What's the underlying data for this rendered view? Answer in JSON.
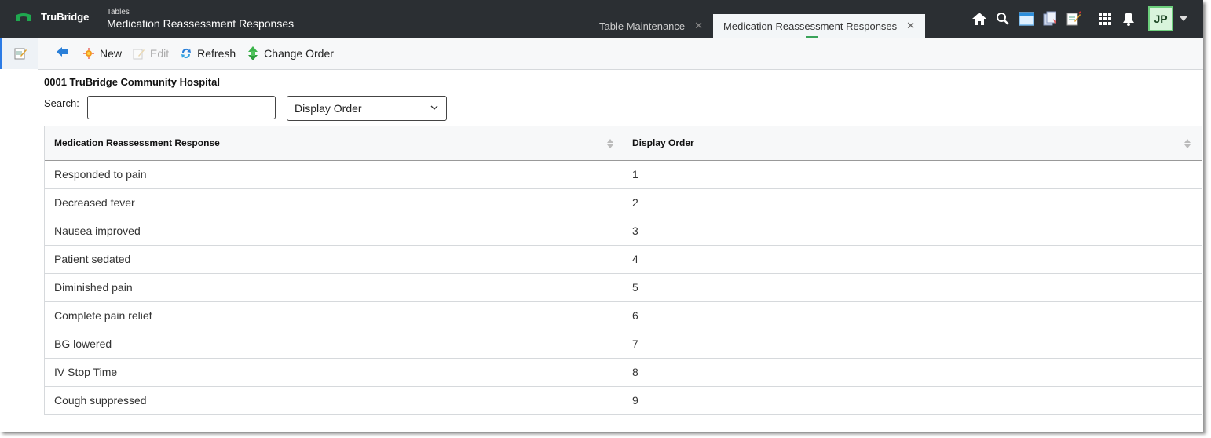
{
  "brand": {
    "name": "TruBridge",
    "accent": "#1fa84f"
  },
  "header": {
    "section": "Tables",
    "title": "Medication Reassessment Responses"
  },
  "tabs": [
    {
      "label": "Table Maintenance",
      "active": false
    },
    {
      "label": "Medication Reassessment Responses",
      "active": true
    }
  ],
  "top_icons": [
    "home-icon",
    "search-icon",
    "window-icon",
    "documents-icon",
    "notes-icon",
    "apps-grid-icon",
    "bell-icon"
  ],
  "user": {
    "initials": "JP"
  },
  "toolbar": {
    "new_label": "New",
    "edit_label": "Edit",
    "refresh_label": "Refresh",
    "change_order_label": "Change Order"
  },
  "facility": "0001 TruBridge Community Hospital",
  "search": {
    "label": "Search:",
    "value": "",
    "sort_selected": "Display Order"
  },
  "table": {
    "columns": [
      "Medication Reassessment Response",
      "Display Order"
    ],
    "rows": [
      {
        "response": "Responded to pain",
        "order": "1"
      },
      {
        "response": "Decreased fever",
        "order": "2"
      },
      {
        "response": "Nausea improved",
        "order": "3"
      },
      {
        "response": "Patient sedated",
        "order": "4"
      },
      {
        "response": "Diminished pain",
        "order": "5"
      },
      {
        "response": "Complete pain relief",
        "order": "6"
      },
      {
        "response": "BG lowered",
        "order": "7"
      },
      {
        "response": "IV Stop Time",
        "order": "8"
      },
      {
        "response": "Cough suppressed",
        "order": "9"
      }
    ]
  }
}
